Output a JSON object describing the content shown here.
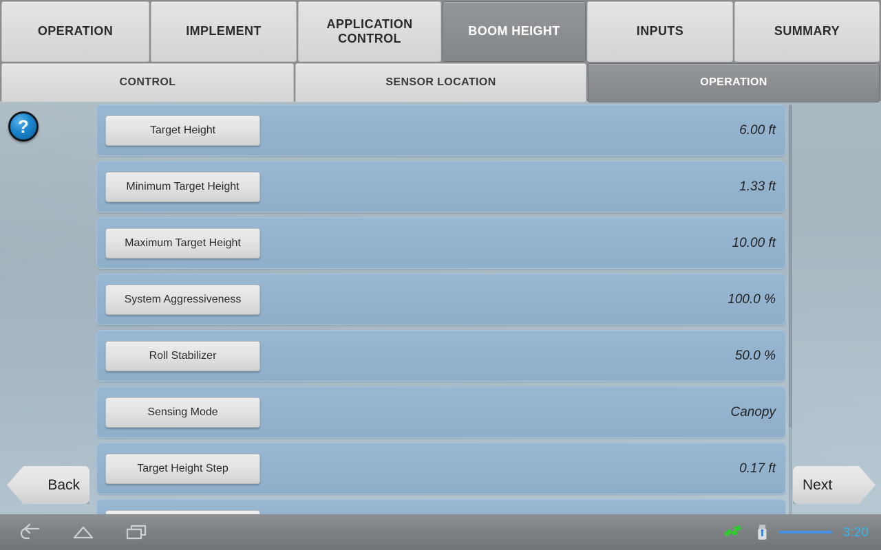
{
  "tabs_primary": [
    {
      "label": "OPERATION",
      "active": false,
      "name": "tab-operation"
    },
    {
      "label": "IMPLEMENT",
      "active": false,
      "name": "tab-implement"
    },
    {
      "label": "APPLICATION CONTROL",
      "active": false,
      "name": "tab-application-control"
    },
    {
      "label": "BOOM HEIGHT",
      "active": true,
      "name": "tab-boom-height"
    },
    {
      "label": "INPUTS",
      "active": false,
      "name": "tab-inputs"
    },
    {
      "label": "SUMMARY",
      "active": false,
      "name": "tab-summary"
    }
  ],
  "tabs_secondary": [
    {
      "label": "CONTROL",
      "active": false,
      "name": "subtab-control"
    },
    {
      "label": "SENSOR LOCATION",
      "active": false,
      "name": "subtab-sensor-location"
    },
    {
      "label": "OPERATION",
      "active": true,
      "name": "subtab-operation"
    }
  ],
  "help": {
    "glyph": "?",
    "icon": "help-question-icon"
  },
  "settings_rows": [
    {
      "label": "Target Height",
      "value": "6.00 ft"
    },
    {
      "label": "Minimum Target Height",
      "value": "1.33 ft"
    },
    {
      "label": "Maximum Target Height",
      "value": "10.00 ft"
    },
    {
      "label": "System Aggressiveness",
      "value": "100.0 %"
    },
    {
      "label": "Roll Stabilizer",
      "value": "50.0 %"
    },
    {
      "label": "Sensing Mode",
      "value": "Canopy"
    },
    {
      "label": "Target Height Step",
      "value": "0.17 ft"
    },
    {
      "label": "",
      "value": ""
    }
  ],
  "nav": {
    "back_label": "Back",
    "next_label": "Next"
  },
  "system_bar": {
    "back_icon": "android-back-icon",
    "home_icon": "android-home-icon",
    "recents_icon": "android-recents-icon",
    "gps_icon": "satellite-gps-icon",
    "usb_icon": "usb-drive-icon",
    "menu_icon": "hamburger-menu-icon",
    "clock": "3:20"
  },
  "colors": {
    "row_blue": "#92b2ce",
    "active_tab_grey": "#8b8e91",
    "inactive_tab_grey": "#dcdcdc",
    "accent_blue": "#2fb8f0",
    "gps_green": "#33cc33"
  }
}
